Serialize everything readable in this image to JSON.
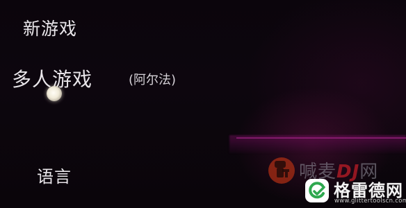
{
  "menu": {
    "new_game": "新游戏",
    "multiplayer": "多人游戏",
    "multiplayer_tag": "(阿尔法)",
    "language": "语言"
  },
  "watermarks": {
    "brand_a": {
      "text_main": "喊麦",
      "text_accent": "DJ",
      "text_tail": "网"
    },
    "brand_b": {
      "title": "格雷德网",
      "url": "www.glittertoolscn.com",
      "icon": "g-check-logo-icon"
    }
  },
  "colors": {
    "background": "#0a040b",
    "menu_text": "#e9e6ea",
    "shelf_glow": "#6e0f5a"
  }
}
